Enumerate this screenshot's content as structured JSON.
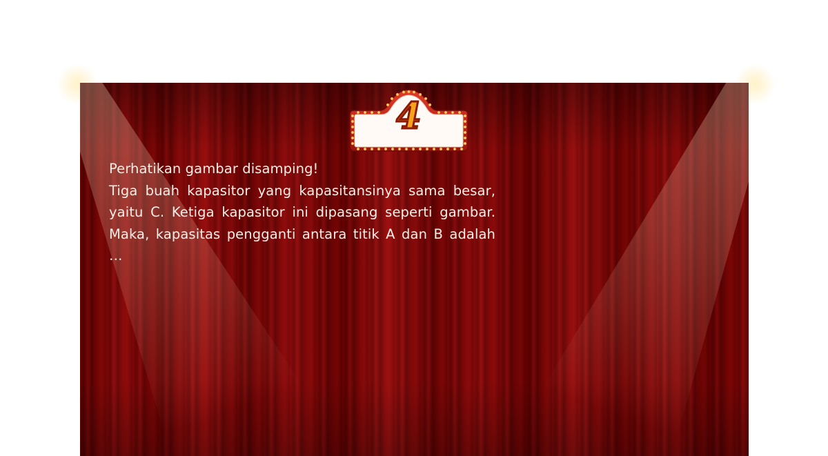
{
  "marquee": {
    "number": "4"
  },
  "question": {
    "intro": "Perhatikan gambar disamping!",
    "body": "Tiga buah kapasitor yang kapasitansinya sama besar, yaitu C. Ketiga kapasitor ini dipasang seperti gambar. Maka, kapasitas pengganti antara titik A dan B adalah …"
  },
  "colors": {
    "curtain": "#7d0606",
    "text": "#fbeee6",
    "marquee_number": "#f7a21b",
    "marquee_frame": "#c0241a",
    "marquee_bulb": "#ffd27a"
  }
}
